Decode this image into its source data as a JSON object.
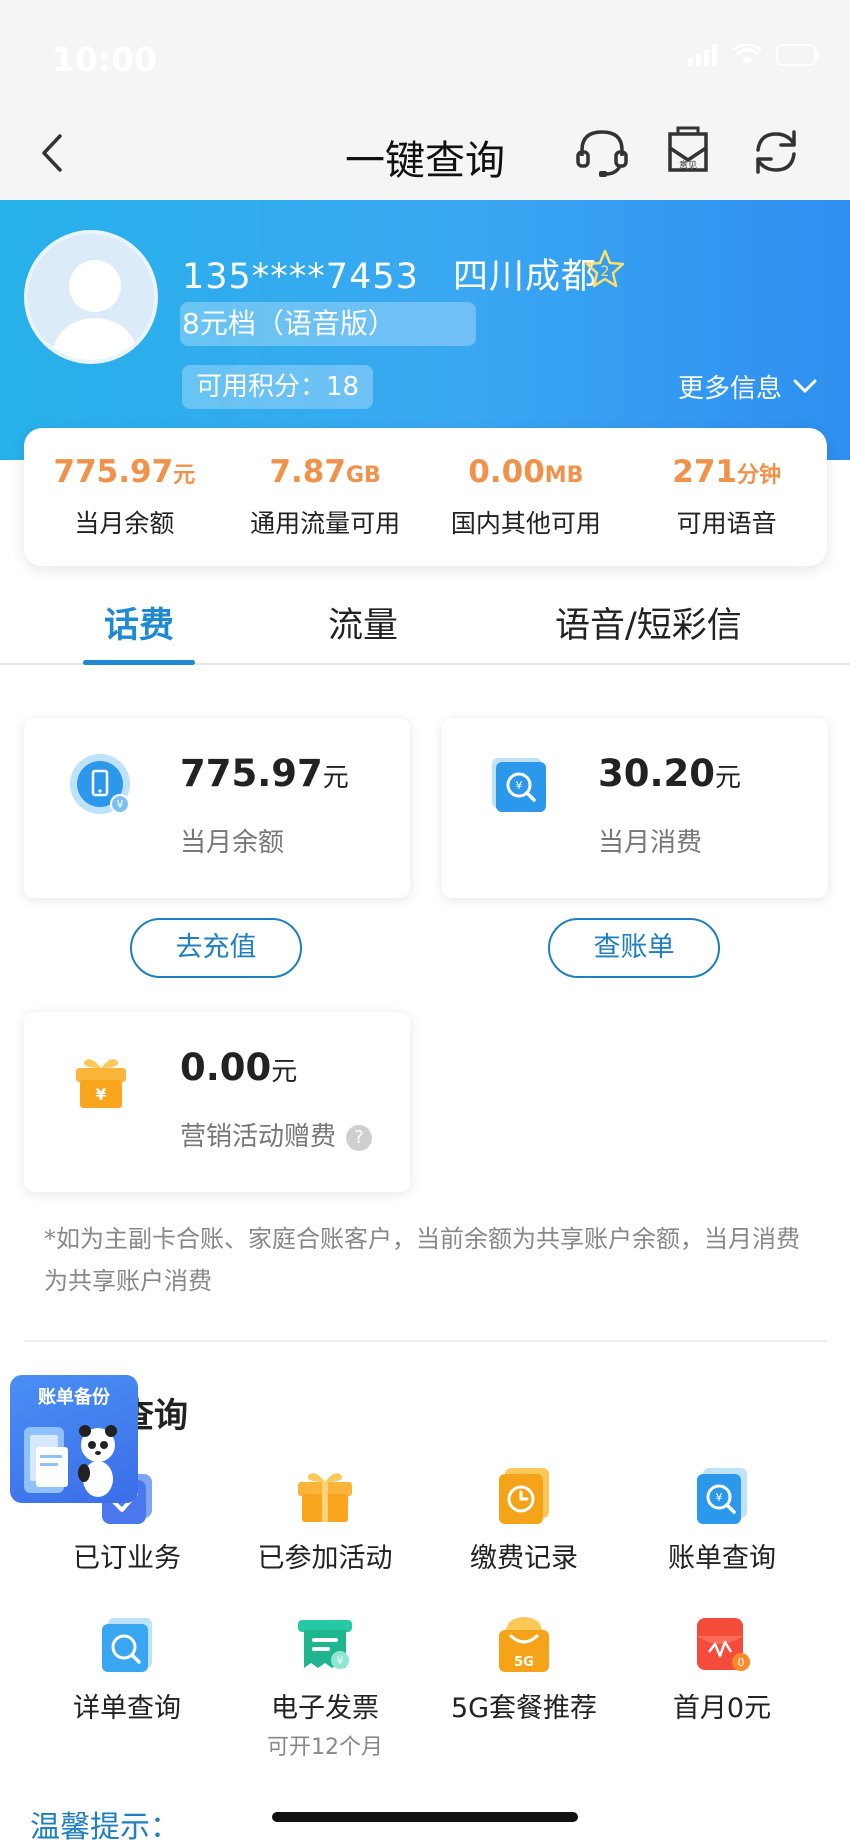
{
  "status_bar": {
    "time": "10:00"
  },
  "nav": {
    "title": "一键查询",
    "feedback_label": "意见"
  },
  "account": {
    "phone": "135****7453",
    "location": "四川成都",
    "star_level": "2",
    "plan": "8元档（语音版）",
    "points": "可用积分：18",
    "more_info": "更多信息"
  },
  "summary": [
    {
      "value": "775.97",
      "unit": "元",
      "label": "当月余额"
    },
    {
      "value": "7.87",
      "unit": "GB",
      "label": "通用流量可用"
    },
    {
      "value": "0.00",
      "unit": "MB",
      "label": "国内其他可用"
    },
    {
      "value": "271",
      "unit": "分钟",
      "label": "可用语音"
    }
  ],
  "tabs": [
    {
      "label": "话费",
      "active": true
    },
    {
      "label": "流量",
      "active": false
    },
    {
      "label": "语音/短彩信",
      "active": false
    }
  ],
  "cards": {
    "balance": {
      "value": "775.97",
      "unit": "元",
      "label": "当月余额",
      "button": "去充值"
    },
    "consumption": {
      "value": "30.20",
      "unit": "元",
      "label": "当月消费",
      "button": "查账单"
    },
    "promo": {
      "value": "0.00",
      "unit": "元",
      "label": "营销活动赠费",
      "help": "?"
    }
  },
  "note": "*如为主副卡合账、家庭合账客户，当前余额为共享账户余额，当月消费为共享账户消费",
  "section": {
    "title": "查询"
  },
  "backup_badge": {
    "label": "账单备份"
  },
  "grid": [
    {
      "label": "已订业务",
      "icon": "subscribed-services-icon"
    },
    {
      "label": "已参加活动",
      "icon": "gift-activity-icon"
    },
    {
      "label": "缴费记录",
      "icon": "payment-record-icon"
    },
    {
      "label": "账单查询",
      "icon": "bill-query-icon"
    },
    {
      "label": "详单查询",
      "icon": "detail-query-icon"
    },
    {
      "label": "电子发票",
      "sub": "可开12个月",
      "icon": "e-invoice-icon"
    },
    {
      "label": "5G套餐推荐",
      "icon": "5g-package-icon"
    },
    {
      "label": "首月0元",
      "icon": "red-envelope-icon"
    }
  ],
  "tips": {
    "label": "温馨提示："
  },
  "colors": {
    "accent": "#1f8ad2",
    "orange": "#f0924a",
    "header_start": "#27b1ea",
    "header_end": "#2e8ff0"
  }
}
